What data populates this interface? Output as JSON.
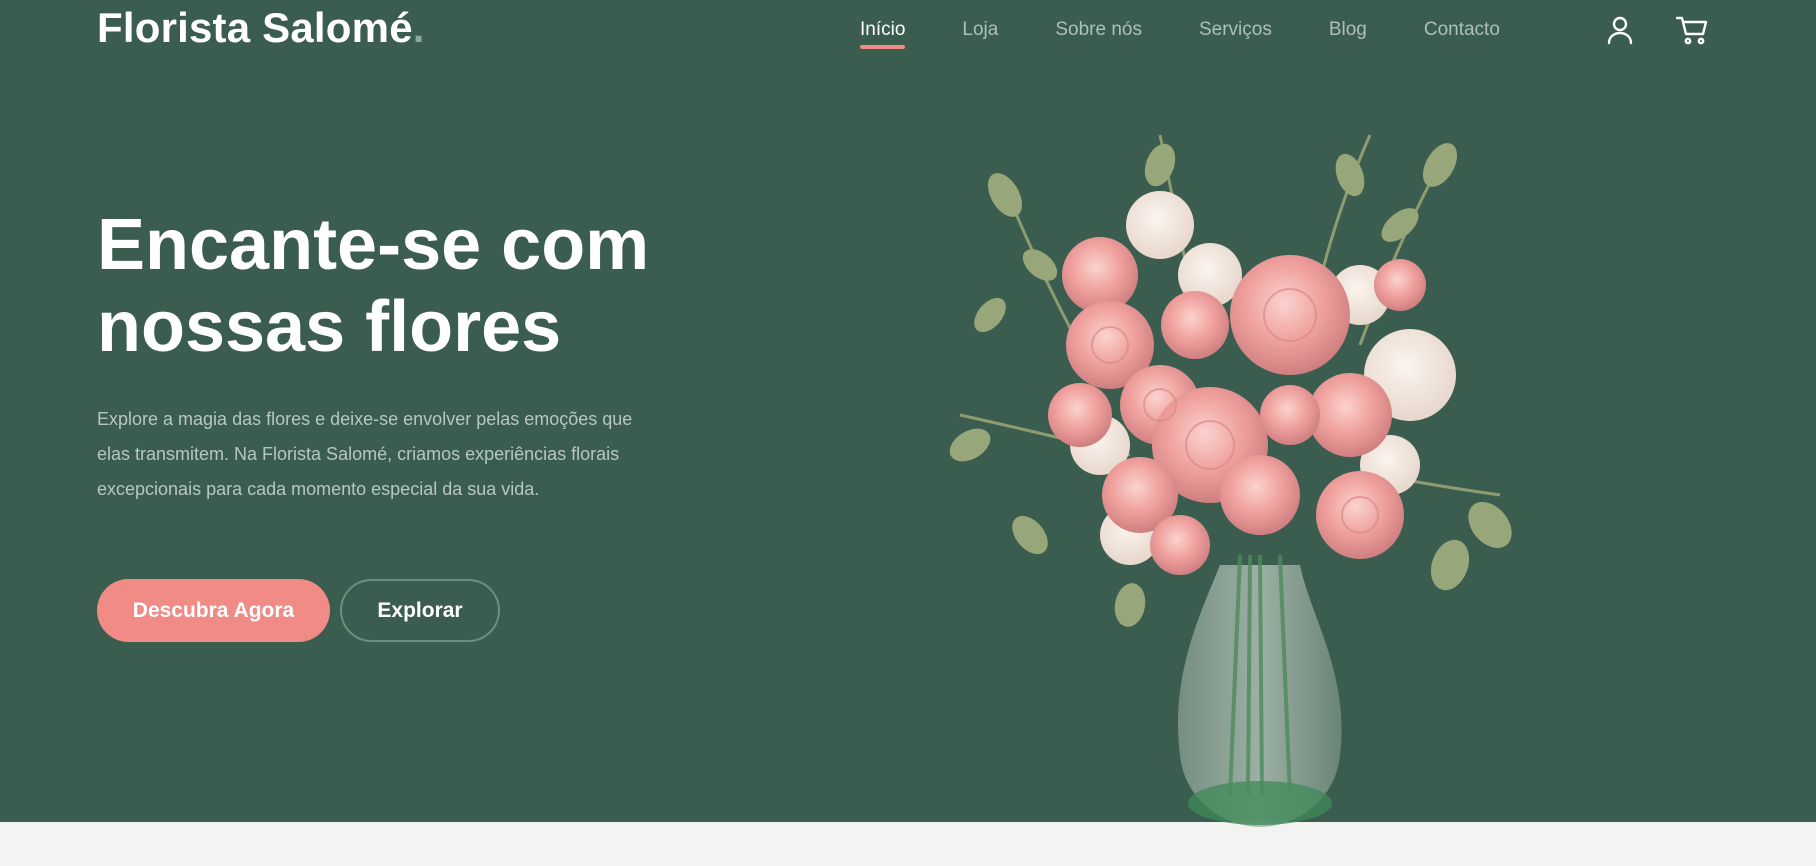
{
  "brand": {
    "name": "Florista Salomé",
    "dot": "."
  },
  "nav": {
    "items": [
      {
        "label": "Início",
        "active": true
      },
      {
        "label": "Loja",
        "active": false
      },
      {
        "label": "Sobre nós",
        "active": false
      },
      {
        "label": "Serviços",
        "active": false
      },
      {
        "label": "Blog",
        "active": false
      },
      {
        "label": "Contacto",
        "active": false
      }
    ]
  },
  "header_icons": [
    "user-icon",
    "cart-icon"
  ],
  "hero": {
    "headline_line1": "Encante-se com",
    "headline_line2": "nossas flores",
    "lead": "Explore a magia das flores e deixe-se envolver pelas emoções que elas transmitem. Na Florista Salomé, criamos experiências florais excepcionais para cada momento especial da sua vida.",
    "primary_button": "Descubra Agora",
    "secondary_button": "Explorar"
  },
  "colors": {
    "hero_background": "#3b5d50",
    "accent": "#f08b86",
    "page_background": "#f3f3f2"
  }
}
